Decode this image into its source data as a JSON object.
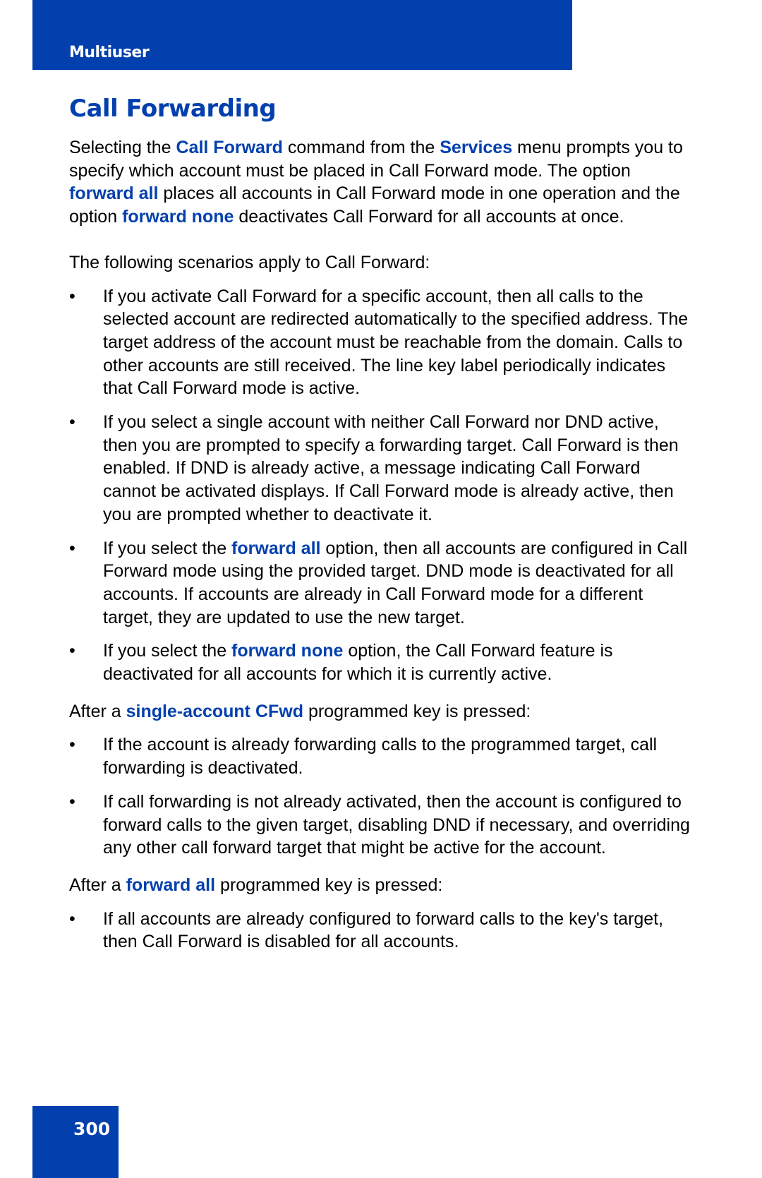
{
  "header": {
    "section": "Multiuser"
  },
  "title": "Call Forwarding",
  "intro": {
    "p1": "Selecting the ",
    "k1": "Call Forward",
    "p2": " command from the ",
    "k2": "Services",
    "p3": " menu prompts you to specify which account must be placed in Call Forward mode. The option ",
    "k3": "forward all",
    "p4": " places all accounts in Call Forward mode in one operation and the option ",
    "k4": "forward none",
    "p5": " deactivates Call Forward for all accounts at once."
  },
  "scenarios_lead": "The following scenarios apply to Call Forward:",
  "scenarios": {
    "b1": "If you activate Call Forward for a specific account, then all calls to the selected account are redirected automatically to the specified address. The target address of the account must be reachable from the domain. Calls to other accounts are still received. The line key label periodically indicates that Call Forward mode is active.",
    "b2": "If you select a single account with neither Call Forward nor DND active, then you are prompted to specify a forwarding target. Call Forward is then enabled. If DND is already active, a message indicating Call Forward cannot be activated displays. If Call Forward mode is already active, then you are prompted whether to deactivate it.",
    "b3_pre": "If you select the ",
    "b3_kw": "forward all",
    "b3_post": " option, then all accounts are configured in Call Forward mode using the provided target. DND mode is deactivated for all accounts. If accounts are already in Call Forward mode for a different target, they are updated to use the new target.",
    "b4_pre": "If you select the ",
    "b4_kw": "forward none",
    "b4_post": " option, the Call Forward feature is deactivated for all accounts for which it is currently active."
  },
  "single_account": {
    "pre": "After a ",
    "kw": "single-account CFwd",
    "post": " programmed key is pressed:",
    "b1": "If the account is already forwarding calls to the programmed target, call forwarding is deactivated.",
    "b2": "If call forwarding is not already activated, then the account is configured to forward calls to the given target, disabling DND if necessary, and overriding any other call forward target that might be active for the account."
  },
  "forward_all": {
    "pre": "After a ",
    "kw": "forward all",
    "post": " programmed key is pressed:",
    "b1": "If all accounts are already configured to forward calls to the key's target, then Call Forward is disabled for all accounts."
  },
  "bullet_glyph": "•",
  "page_number": "300",
  "colors": {
    "accent": "#0340ad",
    "text": "#000000"
  }
}
